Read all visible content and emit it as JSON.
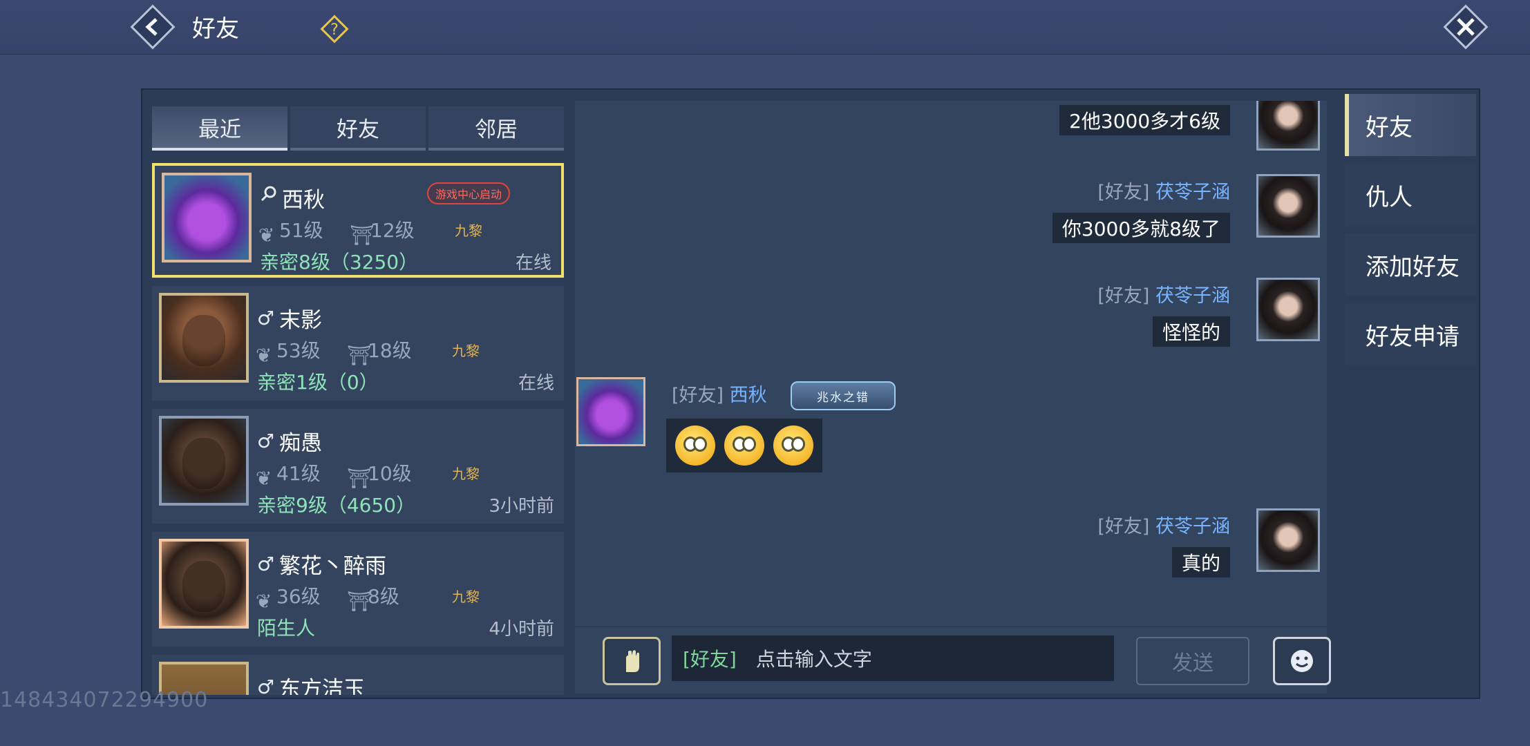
{
  "header": {
    "title": "好友"
  },
  "tabs": [
    "最近",
    "好友",
    "邻居"
  ],
  "contacts": [
    {
      "name": "西秋",
      "gender_icon": "search-icon",
      "badge": "游戏中心启动",
      "level": "51级",
      "house_level": "12级",
      "guild": "九黎",
      "intimacy": "亲密8级（3250）",
      "status": "在线"
    },
    {
      "name": "末影",
      "gender_icon": "male-icon",
      "level": "53级",
      "house_level": "18级",
      "guild": "九黎",
      "intimacy": "亲密1级（0）",
      "status": "在线"
    },
    {
      "name": "痴愚",
      "gender_icon": "male-icon",
      "level": "41级",
      "house_level": "10级",
      "guild": "九黎",
      "intimacy": "亲密9级（4650）",
      "status": "3小时前"
    },
    {
      "name": "繁花丶醉雨",
      "gender_icon": "male-icon",
      "level": "36级",
      "house_level": "8级",
      "guild": "九黎",
      "intimacy": "陌生人",
      "status": "4小时前"
    },
    {
      "name": "东方洁玉",
      "gender_icon": "male-icon"
    }
  ],
  "chat": {
    "messages": [
      {
        "side": "right",
        "text": "2他3000多才6级"
      },
      {
        "side": "right",
        "channel": "[好友]",
        "sender": "茯苓子涵",
        "text": "你3000多就8级了"
      },
      {
        "side": "right",
        "channel": "[好友]",
        "sender": "茯苓子涵",
        "text": "怪怪的"
      },
      {
        "side": "left",
        "channel": "[好友]",
        "sender": "西秋",
        "title_badge": "兆水之错"
      },
      {
        "side": "right",
        "channel": "[好友]",
        "sender": "茯苓子涵",
        "text": "真的"
      }
    ]
  },
  "input": {
    "channel": "[好友]",
    "placeholder": "点击输入文字",
    "send_label": "发送"
  },
  "side_menu": [
    "好友",
    "仇人",
    "添加好友",
    "好友申请"
  ],
  "watermark": "148434072294900",
  "colors": {
    "selected_border": "#f1e06a",
    "intimacy": "#8fe3b9",
    "name_link": "#78b4ff",
    "guild": "#e3b34d"
  }
}
